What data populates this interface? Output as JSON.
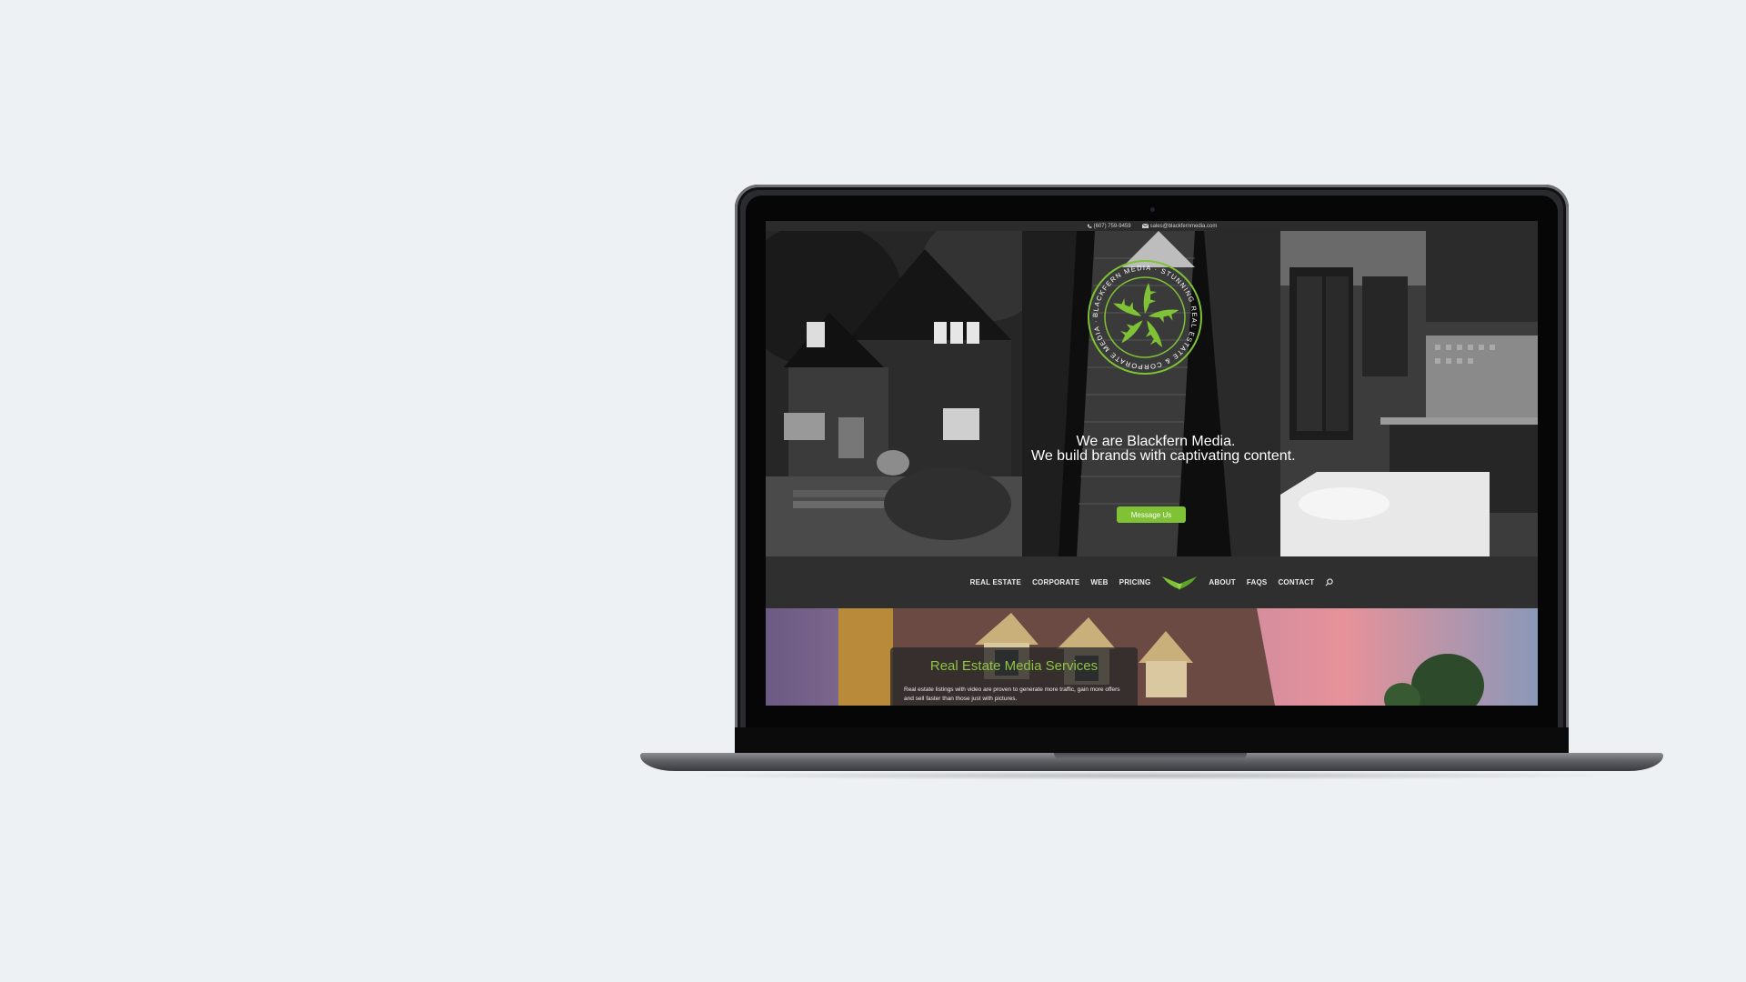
{
  "topbar": {
    "phone": "(607) 759-9459",
    "email": "sales@blackfernmedia.com",
    "phone_icon": "phone-icon",
    "email_icon": "envelope-icon"
  },
  "logo": {
    "ring_text": "BLACKFERN MEDIA · STUNNING REAL ESTATE & CORPORATE MEDIA ·",
    "accent": "#7fc236"
  },
  "hero": {
    "line1": "We are Blackfern Media.",
    "line2": "We build brands with captivating content.",
    "cta": "Message Us"
  },
  "nav": {
    "left": [
      "REAL ESTATE",
      "CORPORATE",
      "WEB",
      "PRICING"
    ],
    "right": [
      "ABOUT",
      "FAQS",
      "CONTACT"
    ],
    "search_icon": "search-icon"
  },
  "services": {
    "title": "Real Estate Media Services",
    "body": "Real estate listings with video are proven to generate more traffic, gain more offers and sell faster than those just with pictures."
  }
}
